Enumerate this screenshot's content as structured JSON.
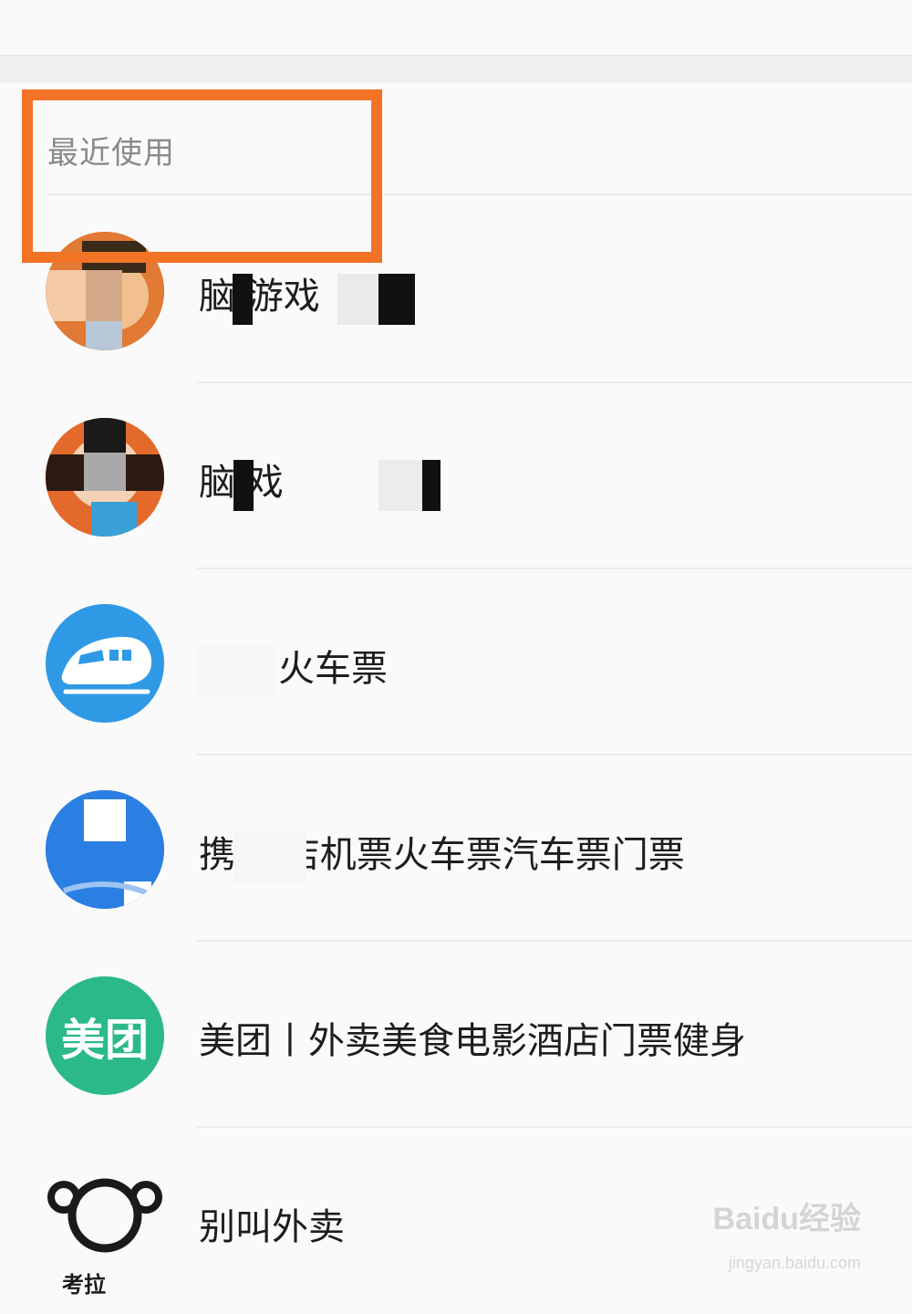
{
  "section": {
    "title": "最近使用"
  },
  "apps": [
    {
      "label": "脑 游戏",
      "icon": "game-avatar-icon"
    },
    {
      "label": "脑 戏",
      "icon": "game-avatar-icon"
    },
    {
      "label": "火车票",
      "icon": "train-icon",
      "color": "#2f99e6"
    },
    {
      "label": "携 酒店机票火车票汽车票门票",
      "icon": "ctrip-icon",
      "color": "#2b7fe3"
    },
    {
      "label": "美团丨外卖美食电影酒店门票健身",
      "icon": "meituan-icon",
      "icon_text": "美团",
      "color": "#2bb98a"
    },
    {
      "label": "别叫外卖",
      "icon": "koala-icon",
      "icon_text": "考拉"
    }
  ],
  "watermark": {
    "text": "Baidu经验",
    "url": "jingyan.baidu.com"
  },
  "highlight": {
    "color": "#f27326"
  }
}
